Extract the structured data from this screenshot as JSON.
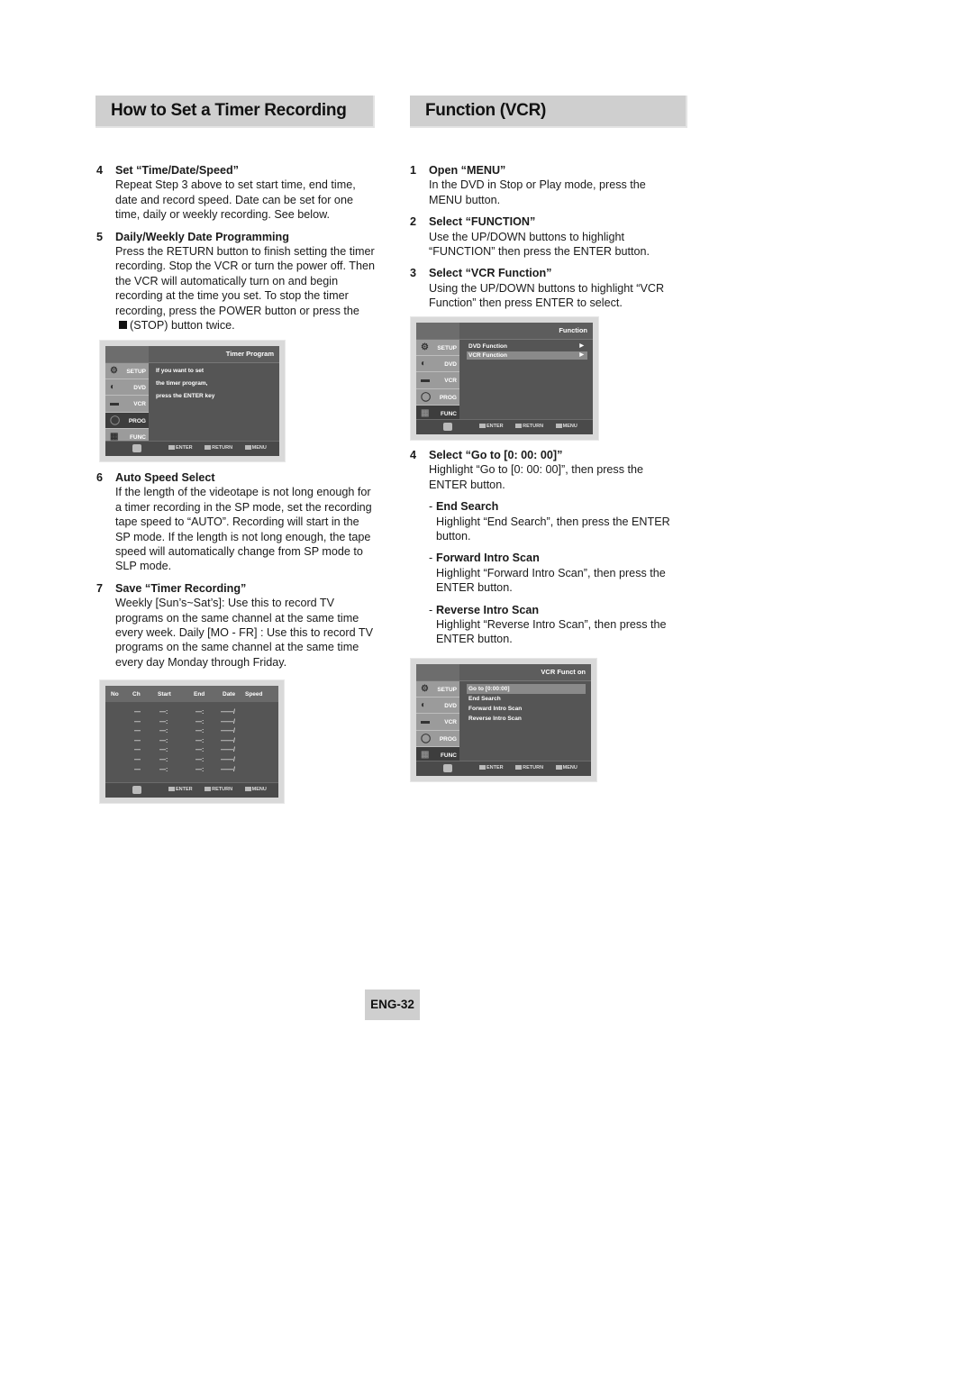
{
  "headers": {
    "left": "How to Set a Timer Recording",
    "right": "Function (VCR)"
  },
  "left_steps": [
    {
      "num": "4",
      "title": "Set “Time/Date/Speed”",
      "body": "Repeat Step 3 above to set start time, end time, date and record speed. Date can be set for one time, daily or weekly recording. See below."
    },
    {
      "num": "5",
      "title": "Daily/Weekly Date Programming",
      "body": "Press the RETURN button to finish setting the timer recording. Stop the VCR or turn the power off. Then the VCR will automatically turn on and begin recording at the time you set. To stop the timer recording, press the POWER button or press the",
      "body_tail": "(STOP) button twice."
    },
    {
      "num": "6",
      "title": "Auto Speed Select",
      "body": "If the length of the videotape is not long enough for a timer recording in the SP mode, set the recording tape speed to “AUTO”. Recording will start in the SP mode. If the length is not long enough, the tape speed will automatically change from SP mode to SLP mode."
    },
    {
      "num": "7",
      "title": "Save “Timer Recording”",
      "body": "Weekly [Sun’s~Sat’s]: Use this to record TV programs on the same channel at the same time every week. Daily [MO - FR] : Use this to record TV programs on the same channel at the same time every day Monday through Friday."
    }
  ],
  "right_steps": [
    {
      "num": "1",
      "title": "Open “MENU”",
      "body": "In the DVD in Stop or Play mode, press the MENU button."
    },
    {
      "num": "2",
      "title": "Select “FUNCTION”",
      "body": "Use the UP/DOWN buttons to highlight “FUNCTION” then press the ENTER button."
    },
    {
      "num": "3",
      "title": "Select “VCR Function”",
      "body": "Using the UP/DOWN buttons to highlight “VCR Function”  then press ENTER to select."
    },
    {
      "num": "4",
      "title": "Select “Go to [0: 00: 00]”",
      "body": "Highlight “Go to [0: 00: 00]”, then press the ENTER button."
    }
  ],
  "right_substeps": [
    {
      "dash": "-",
      "title": "End Search",
      "body": "Highlight “End Search”, then press the ENTER button."
    },
    {
      "dash": "-",
      "title": "Forward Intro Scan",
      "body": "Highlight “Forward Intro Scan”, then press the ENTER button."
    },
    {
      "dash": "-",
      "title": "Reverse Intro Scan",
      "body": "Highlight “Reverse Intro Scan”, then press the ENTER button."
    }
  ],
  "osd_common": {
    "sidebar": [
      {
        "label": "SETUP",
        "icon": "gear-icon",
        "glyph": "⚙"
      },
      {
        "label": "DVD",
        "icon": "disc-icon",
        "glyph": "◐"
      },
      {
        "label": "VCR",
        "icon": "vcr-icon",
        "glyph": "▬"
      },
      {
        "label": "PROG",
        "icon": "clock-icon",
        "glyph": "◯"
      },
      {
        "label": "FUNC",
        "icon": "function-icon",
        "glyph": "▦"
      }
    ],
    "keys": {
      "enter": "ENTER",
      "return": "RETURN",
      "menu": "MENU"
    }
  },
  "osd_timer_program": {
    "title": "Timer Program",
    "active": "PROG",
    "lines": [
      "If you want to set",
      "the timer program,",
      "press the ENTER key"
    ]
  },
  "osd_timer_table": {
    "columns": [
      "No",
      "Ch",
      "Start",
      "End",
      "Date",
      "Speed"
    ],
    "rows": [
      [
        "",
        "—",
        "—:",
        "—:",
        "——/",
        ""
      ],
      [
        "",
        "—",
        "—:",
        "—:",
        "——/",
        ""
      ],
      [
        "",
        "—",
        "—:",
        "—:",
        "——/",
        ""
      ],
      [
        "",
        "—",
        "—:",
        "—:",
        "——/",
        ""
      ],
      [
        "",
        "—",
        "—:",
        "—:",
        "——/",
        ""
      ],
      [
        "",
        "—",
        "—:",
        "—:",
        "——/",
        ""
      ],
      [
        "",
        "—",
        "—:",
        "—:",
        "——/",
        ""
      ]
    ]
  },
  "osd_function": {
    "title": "Function",
    "active": "FUNC",
    "items": [
      {
        "label": "DVD Function",
        "arrow": "▶",
        "highlighted": false
      },
      {
        "label": "VCR Function",
        "arrow": "▶",
        "highlighted": true
      }
    ]
  },
  "osd_vcr_function": {
    "title": "VCR Funct on",
    "active": "FUNC",
    "items": [
      {
        "label": "Go to [0:00:00]",
        "highlighted": true
      },
      {
        "label": "End Search",
        "highlighted": false
      },
      {
        "label": "Forward Intro Scan",
        "highlighted": false
      },
      {
        "label": "Reverse Intro Scan",
        "highlighted": false
      }
    ]
  },
  "page_number": "ENG-32"
}
